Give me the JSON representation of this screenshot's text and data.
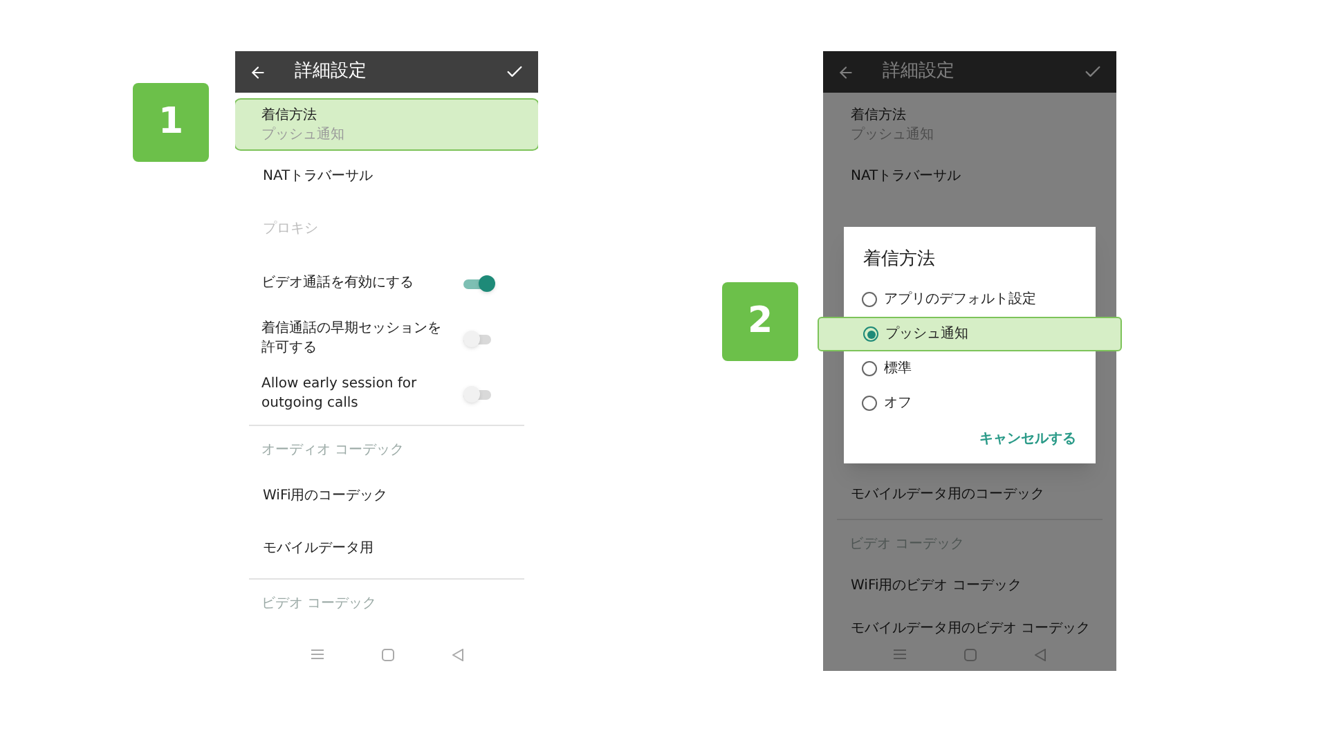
{
  "panels": [
    {
      "kind": "settings",
      "badge": "1",
      "app_bar": {
        "title": "詳細設定"
      },
      "items": [
        {
          "kind": "pref",
          "title": "着信方法",
          "summary": "プッシュ通知",
          "highlighted": true,
          "disabled": false
        },
        {
          "kind": "pref",
          "title": "NATトラバーサル",
          "highlighted": false,
          "disabled": false
        },
        {
          "kind": "pref",
          "title": "プロキシ",
          "highlighted": false,
          "disabled": true
        },
        {
          "kind": "switch",
          "title": "ビデオ通話を有効にする",
          "on": true
        },
        {
          "kind": "switch",
          "title": "着信通話の早期セッションを許可する",
          "on": false
        },
        {
          "kind": "switch",
          "title": "Allow early session for outgoing calls",
          "on": false
        },
        {
          "kind": "divider"
        },
        {
          "kind": "category",
          "title": "オーディオ コーデック"
        },
        {
          "kind": "pref",
          "title": "WiFi用のコーデック",
          "highlighted": false,
          "disabled": false
        },
        {
          "kind": "pref",
          "title": "モバイルデータ用",
          "highlighted": false,
          "disabled": false
        },
        {
          "kind": "divider"
        },
        {
          "kind": "category",
          "title": "ビデオ コーデック"
        }
      ]
    },
    {
      "kind": "dialog",
      "badge": "2",
      "app_bar": {
        "title": "詳細設定"
      },
      "items_top": [
        {
          "kind": "pref",
          "title": "着信方法",
          "summary": "プッシュ通知",
          "highlighted": false,
          "disabled": false
        },
        {
          "kind": "pref",
          "title": "NATトラバーサル",
          "highlighted": false,
          "disabled": false
        }
      ],
      "items_bottom": [
        {
          "kind": "pref",
          "title": "モバイルデータ用のコーデック",
          "highlighted": false,
          "disabled": false
        },
        {
          "kind": "divider"
        },
        {
          "kind": "category",
          "title": "ビデオ コーデック"
        },
        {
          "kind": "pref",
          "title": "WiFi用のビデオ コーデック",
          "highlighted": false,
          "disabled": false
        },
        {
          "kind": "pref",
          "title": "モバイルデータ用のビデオ コーデック",
          "highlighted": false,
          "disabled": false
        }
      ],
      "dialog": {
        "title": "着信方法",
        "options": [
          {
            "label": "アプリのデフォルト設定",
            "selected": false,
            "highlighted": false
          },
          {
            "label": "プッシュ通知",
            "selected": true,
            "highlighted": true
          },
          {
            "label": "標準",
            "selected": false,
            "highlighted": false
          },
          {
            "label": "オフ",
            "selected": false,
            "highlighted": false
          }
        ],
        "cancel": "キャンセルする"
      }
    }
  ]
}
